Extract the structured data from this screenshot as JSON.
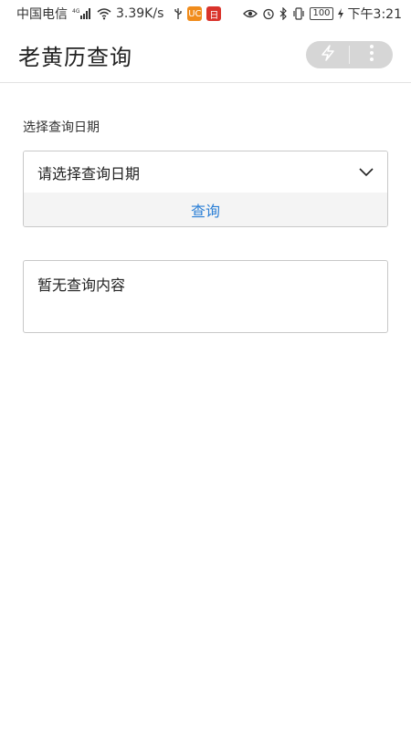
{
  "status_bar": {
    "carrier": "中国电信",
    "network": "4G",
    "speed": "3.39K/s",
    "battery": "100",
    "time": "下午3:21",
    "app_icon_1": "UC",
    "app_icon_2": "日"
  },
  "app_bar": {
    "title": "老黄历查询"
  },
  "form": {
    "section_label": "选择查询日期",
    "date_placeholder": "请选择查询日期",
    "query_button": "查询"
  },
  "result": {
    "empty_text": "暂无查询内容"
  },
  "colors": {
    "accent": "#2b7fd6",
    "border": "#c8c8c8",
    "button_bg": "#f4f4f4"
  }
}
